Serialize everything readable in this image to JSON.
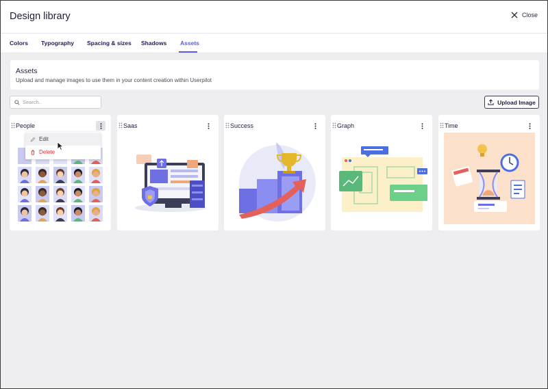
{
  "header": {
    "title": "Design library",
    "close_label": "Close"
  },
  "tabs": [
    {
      "label": "Colors",
      "active": false
    },
    {
      "label": "Typography",
      "active": false
    },
    {
      "label": "Spacing & sizes",
      "active": false
    },
    {
      "label": "Shadows",
      "active": false
    },
    {
      "label": "Assets",
      "active": true
    }
  ],
  "assets": {
    "title": "Assets",
    "subtitle": "Upload and manage images to use them in your content creation within Userpilot"
  },
  "search": {
    "placeholder": "Search.."
  },
  "upload": {
    "label": "Upload Image"
  },
  "cards": [
    {
      "name": "People"
    },
    {
      "name": "Saas"
    },
    {
      "name": "Success"
    },
    {
      "name": "Graph"
    },
    {
      "name": "Time"
    }
  ],
  "menu": {
    "edit_label": "Edit",
    "delete_label": "Delete"
  },
  "colors": {
    "accent": "#5a5be0",
    "danger": "#d9323a",
    "text": "#1d1d3a"
  },
  "icons": [
    "close-icon",
    "search-icon",
    "upload-icon",
    "drag-handle-icon",
    "kebab-icon",
    "pencil-icon",
    "trash-icon"
  ]
}
